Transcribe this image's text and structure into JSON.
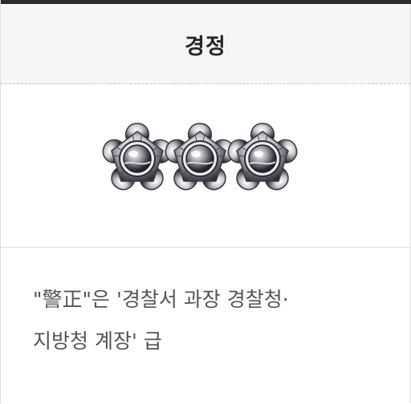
{
  "header": {
    "title": "경정"
  },
  "insignia": {
    "icon": "three-blossom-insignia-icon",
    "count": 3
  },
  "description": {
    "text": "\"警正\"은 '경찰서 과장 경찰청·\n지방청 계장' 급"
  },
  "colors": {
    "header_bg": "#f6f6f6",
    "top_bar": "#2b2b2b",
    "text_main": "#262626",
    "text_desc": "#555555"
  }
}
